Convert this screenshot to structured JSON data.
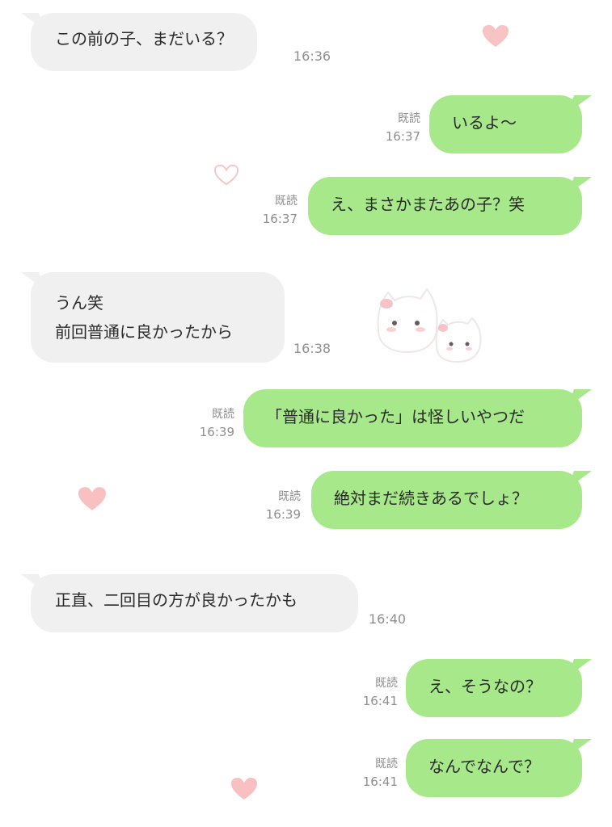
{
  "messages": [
    {
      "side": "in",
      "text": "この前の子、まだいる？",
      "time": "16:36"
    },
    {
      "side": "out",
      "text": "いるよ〜",
      "read": "既読",
      "time": "16:37"
    },
    {
      "side": "out",
      "text": "え、まさかまたあの子？笑",
      "read": "既読",
      "time": "16:37"
    },
    {
      "side": "in",
      "line1": "うん笑",
      "line2": "前回普通に良かったから",
      "time": "16:38"
    },
    {
      "side": "out",
      "text": "「普通に良かった」は怪しいやつだ",
      "read": "既読",
      "time": "16:39"
    },
    {
      "side": "out",
      "text": "絶対まだ続きあるでしょ？",
      "read": "既読",
      "time": "16:39"
    },
    {
      "side": "in",
      "text": "正直、二回目の方が良かったかも",
      "time": "16:40"
    },
    {
      "side": "out",
      "text": "え、そうなの？",
      "read": "既読",
      "time": "16:41"
    },
    {
      "side": "out",
      "text": "なんでなんで？",
      "read": "既読",
      "time": "16:41"
    }
  ],
  "colors": {
    "incoming_bubble": "#f0f0f0",
    "outgoing_bubble": "#a7e98a",
    "meta_text": "#8e8e8e",
    "heart": "#f7b6b6"
  }
}
